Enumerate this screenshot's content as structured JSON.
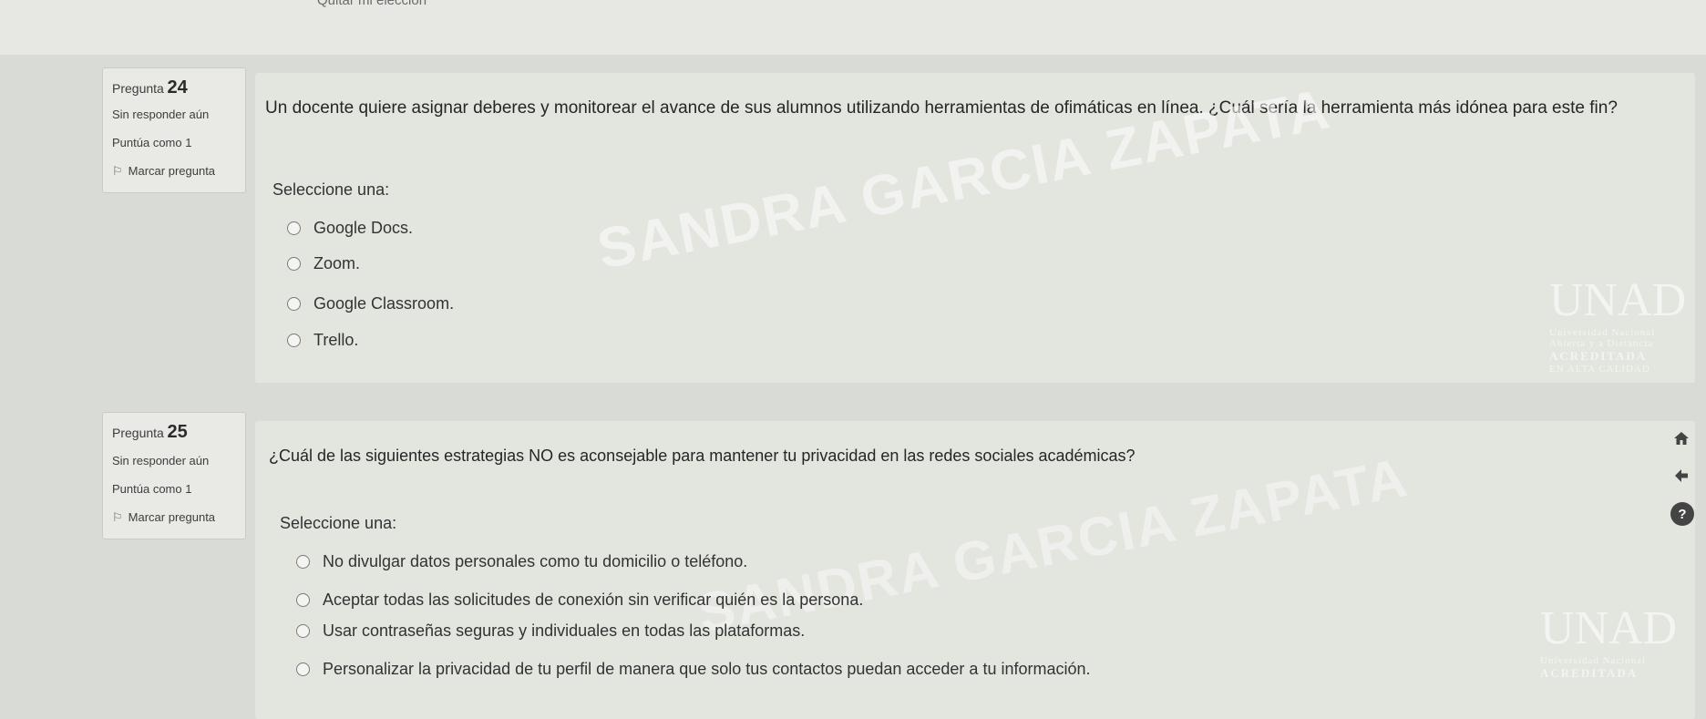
{
  "top": {
    "clipped_link": "Quitar mi elección"
  },
  "questions": [
    {
      "label": "Pregunta",
      "number": "24",
      "status": "Sin responder aún",
      "score": "Puntúa como 1",
      "flag_label": "Marcar pregunta",
      "text": "Un docente quiere asignar deberes y monitorear el avance de sus alumnos utilizando herramientas de ofimáticas en línea. ¿Cuál sería la herramienta más idónea para este fin?",
      "prompt": "Seleccione una:",
      "options": [
        "Google Docs.",
        "Zoom.",
        "Google Classroom.",
        "Trello."
      ]
    },
    {
      "label": "Pregunta",
      "number": "25",
      "status": "Sin responder aún",
      "score": "Puntúa como 1",
      "flag_label": "Marcar pregunta",
      "text": "¿Cuál de las siguientes estrategias NO es aconsejable para mantener tu privacidad en las redes sociales académicas?",
      "prompt": "Seleccione una:",
      "options": [
        "No divulgar datos personales como tu domicilio o teléfono.",
        "Aceptar todas las solicitudes de conexión sin verificar quién es la persona.",
        "Usar contraseñas seguras y individuales en todas las plataformas.",
        "Personalizar la privacidad de tu perfil de manera que solo tus contactos puedan acceder a tu información."
      ]
    }
  ],
  "watermark": {
    "name": "SANDRA GARCIA ZAPATA",
    "logo": "UNAD",
    "univ": "Universidad Nacional",
    "sub": "Abierta y a Distancia",
    "acc": "ACREDITADA",
    "acc_sub": "EN ALTA CALIDAD"
  },
  "icons": {
    "home": "home-icon",
    "back": "arrow-left-icon",
    "help": "help-icon",
    "flag": "flag-icon"
  }
}
